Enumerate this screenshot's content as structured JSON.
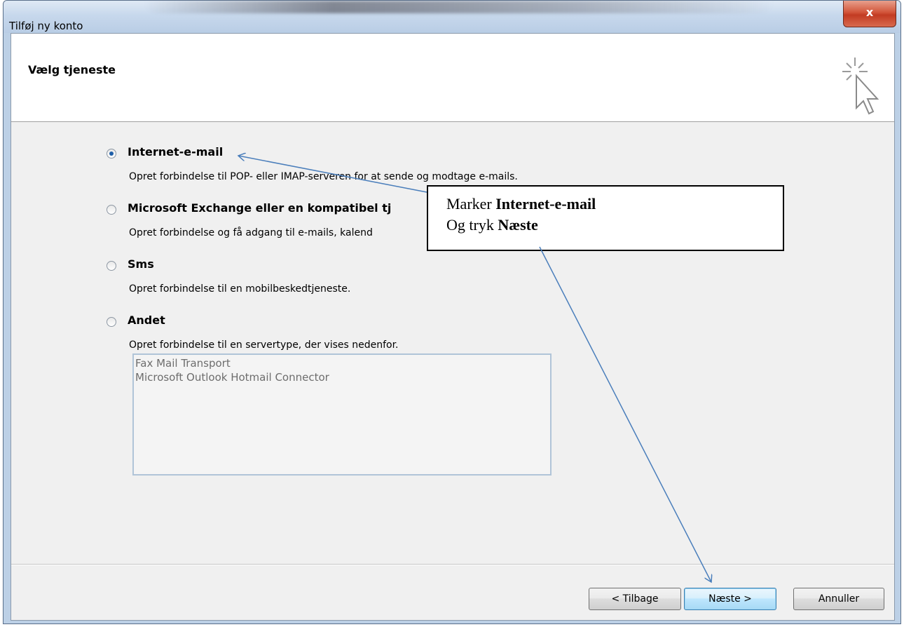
{
  "window": {
    "title": "Tilføj ny konto",
    "close_label": "x"
  },
  "header": {
    "title": "Vælg tjeneste"
  },
  "options": [
    {
      "label": "Internet-e-mail",
      "description": "Opret forbindelse til POP- eller IMAP-serveren for at sende og modtage e-mails.",
      "selected": true
    },
    {
      "label": "Microsoft Exchange eller en kompatibel tj",
      "description": "Opret forbindelse og få adgang til e-mails, kalend",
      "selected": false
    },
    {
      "label": "Sms",
      "description": "Opret forbindelse til en mobilbeskedtjeneste.",
      "selected": false
    },
    {
      "label": "Andet",
      "description": "Opret forbindelse til en servertype, der vises nedenfor.",
      "selected": false
    }
  ],
  "other_servers": [
    "Fax Mail Transport",
    "Microsoft Outlook Hotmail Connector"
  ],
  "buttons": {
    "back": "< Tilbage",
    "next": "Næste >",
    "cancel": "Annuller"
  },
  "callout": {
    "line1_prefix": "Marker",
    "line1_bold": "Internet-e-mail",
    "line2_prefix": "Og tryk",
    "line2_bold": "Næste"
  },
  "colors": {
    "accent": "#4a7ebb",
    "selected_radio": "#1e5fa8",
    "close_button": "#c23b22"
  }
}
